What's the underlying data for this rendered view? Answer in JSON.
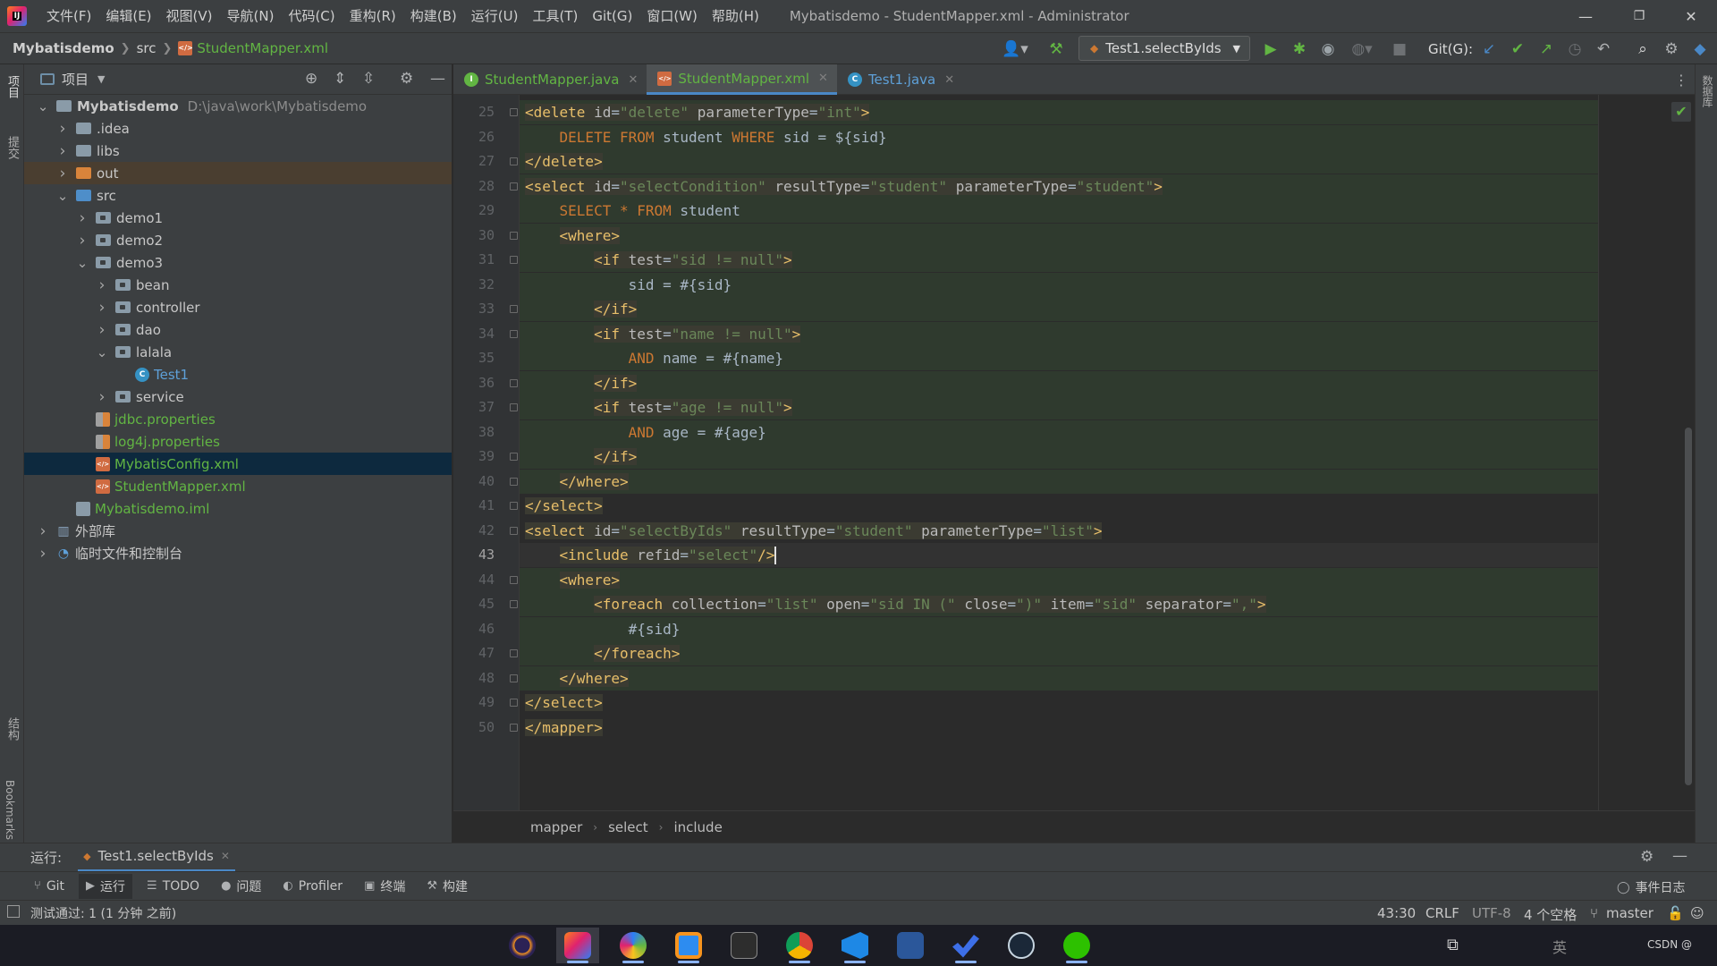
{
  "titlebar": {
    "menus": [
      "文件(F)",
      "编辑(E)",
      "视图(V)",
      "导航(N)",
      "代码(C)",
      "重构(R)",
      "构建(B)",
      "运行(U)",
      "工具(T)",
      "Git(G)",
      "窗口(W)",
      "帮助(H)"
    ],
    "window_title": "Mybatisdemo - StudentMapper.xml - Administrator",
    "controls": {
      "minimize": "—",
      "restore": "❐",
      "close": "✕"
    }
  },
  "navbar": {
    "project": "Mybatisdemo",
    "src": "src",
    "file": "StudentMapper.xml",
    "run_config": "Test1.selectByIds",
    "git_label": "Git(G):"
  },
  "left_strip": {
    "project_label": "项目",
    "commit_label": "提交",
    "structure_label": "结构",
    "bookmarks_label": "Bookmarks"
  },
  "right_strip": {
    "database_label": "数据库"
  },
  "project_panel": {
    "title": "项目",
    "tree": [
      {
        "label": "Mybatisdemo",
        "extra": "D:\\java\\work\\Mybatisdemo",
        "depth": 0,
        "expanded": true,
        "kind": "module"
      },
      {
        "label": ".idea",
        "depth": 1,
        "expanded": false,
        "kind": "folder"
      },
      {
        "label": "libs",
        "depth": 1,
        "expanded": false,
        "kind": "folder"
      },
      {
        "label": "out",
        "depth": 1,
        "expanded": false,
        "kind": "folder-orange"
      },
      {
        "label": "src",
        "depth": 1,
        "expanded": true,
        "kind": "folder-blue"
      },
      {
        "label": "demo1",
        "depth": 2,
        "expanded": false,
        "kind": "package"
      },
      {
        "label": "demo2",
        "depth": 2,
        "expanded": false,
        "kind": "package"
      },
      {
        "label": "demo3",
        "depth": 2,
        "expanded": true,
        "kind": "package"
      },
      {
        "label": "bean",
        "depth": 3,
        "expanded": false,
        "kind": "package"
      },
      {
        "label": "controller",
        "depth": 3,
        "expanded": false,
        "kind": "package"
      },
      {
        "label": "dao",
        "depth": 3,
        "expanded": false,
        "kind": "package"
      },
      {
        "label": "lalala",
        "depth": 3,
        "expanded": true,
        "kind": "package"
      },
      {
        "label": "Test1",
        "depth": 4,
        "kind": "java"
      },
      {
        "label": "service",
        "depth": 3,
        "expanded": false,
        "kind": "package"
      },
      {
        "label": "jdbc.properties",
        "depth": 2,
        "kind": "props"
      },
      {
        "label": "log4j.properties",
        "depth": 2,
        "kind": "props"
      },
      {
        "label": "MybatisConfig.xml",
        "depth": 2,
        "kind": "xml",
        "selected": true
      },
      {
        "label": "StudentMapper.xml",
        "depth": 2,
        "kind": "xml"
      },
      {
        "label": "Mybatisdemo.iml",
        "depth": 1,
        "kind": "iml"
      },
      {
        "label": "外部库",
        "depth": 0,
        "expanded": false,
        "kind": "lib"
      },
      {
        "label": "临时文件和控制台",
        "depth": 0,
        "expanded": false,
        "kind": "scratch"
      }
    ]
  },
  "tabs": [
    {
      "label": "StudentMapper.java",
      "icon": "I",
      "active": false
    },
    {
      "label": "StudentMapper.xml",
      "icon": "xml",
      "active": true
    },
    {
      "label": "Test1.java",
      "icon": "C",
      "active": false
    }
  ],
  "editor": {
    "first_line": 25,
    "current_line": 43,
    "lines": [
      "<delete id=\"delete\" parameterType=\"int\">",
      "    DELETE FROM student WHERE sid = ${sid}",
      "</delete>",
      "<select id=\"selectCondition\" resultType=\"student\" parameterType=\"student\">",
      "    SELECT * FROM student",
      "    <where>",
      "        <if test=\"sid != null\">",
      "            sid = #{sid}",
      "        </if>",
      "        <if test=\"name != null\">",
      "            AND name = #{name}",
      "        </if>",
      "        <if test=\"age != null\">",
      "            AND age = #{age}",
      "        </if>",
      "    </where>",
      "</select>",
      "<select id=\"selectByIds\" resultType=\"student\" parameterType=\"list\">",
      "    <include refid=\"select\"/>",
      "    <where>",
      "        <foreach collection=\"list\" open=\"sid IN (\" close=\")\" item=\"sid\" separator=\",\">",
      "            #{sid}",
      "        </foreach>",
      "    </where>",
      "</select>",
      "</mapper>"
    ]
  },
  "breadcrumbs": [
    "mapper",
    "select",
    "include"
  ],
  "runbar": {
    "label": "运行:",
    "tab": "Test1.selectByIds"
  },
  "tool_windows": [
    "Git",
    "运行",
    "TODO",
    "问题",
    "Profiler",
    "终端",
    "构建"
  ],
  "tool_window_icons": [
    "git-icon",
    "run-icon",
    "todo-icon",
    "problems-icon",
    "profiler-icon",
    "terminal-icon",
    "build-icon"
  ],
  "event_log": "事件日志",
  "status": {
    "message": "测试通过: 1 (1 分钟 之前)",
    "position": "43:30",
    "line_sep": "CRLF",
    "encoding": "UTF-8",
    "indent": "4 个空格",
    "branch": "master"
  },
  "taskbar": {
    "apps": [
      "eclipse",
      "intellij",
      "app3",
      "app4",
      "terminal",
      "chrome",
      "vscode",
      "word",
      "todo",
      "steam",
      "wechat"
    ],
    "tray_text": "CSDN @"
  }
}
